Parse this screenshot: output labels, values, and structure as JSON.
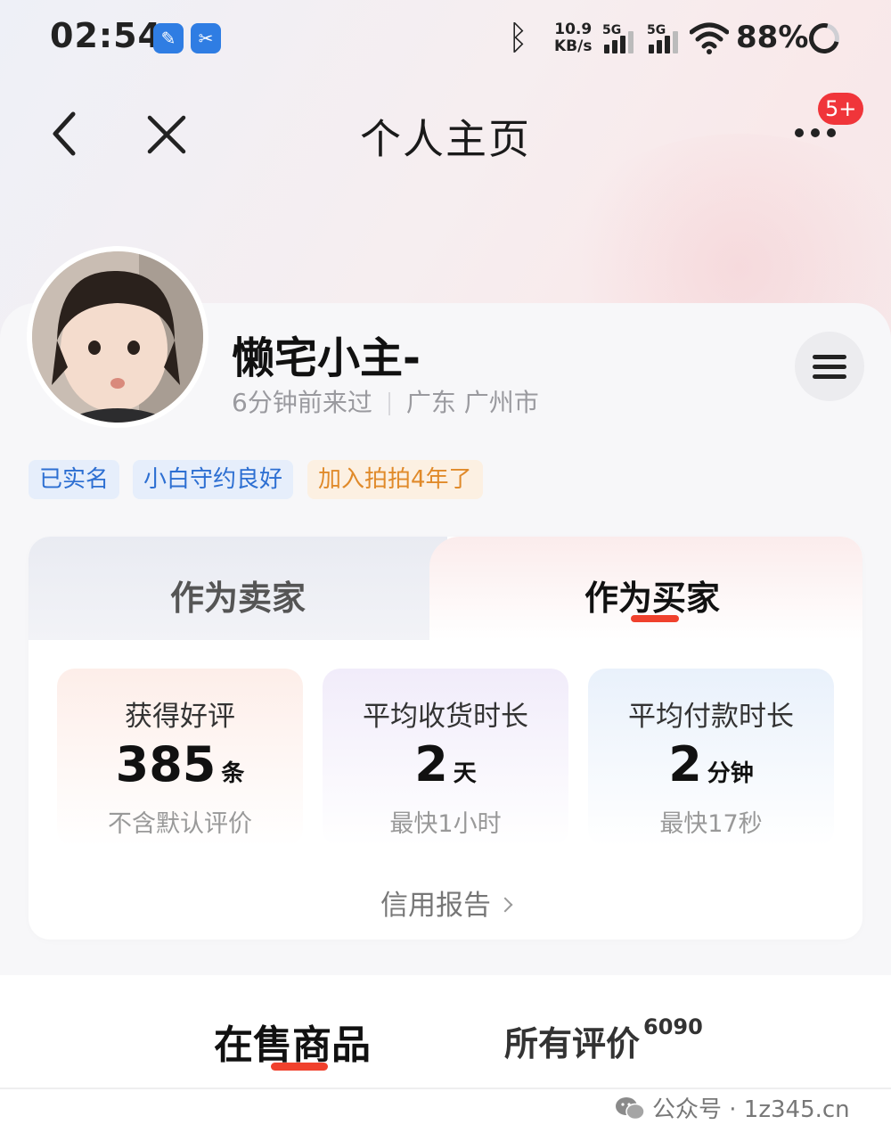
{
  "status_bar": {
    "time": "02:54",
    "net_speed_value": "10.9",
    "net_speed_unit": "KB/s",
    "signal_1_label": "5G",
    "signal_2_label": "5G",
    "battery": "88%"
  },
  "nav": {
    "title": "个人主页",
    "badge": "5+"
  },
  "profile": {
    "username": "懒宅小主-",
    "last_visit": "6分钟前来过",
    "location": "广东 广州市"
  },
  "tags": [
    {
      "label": "已实名"
    },
    {
      "label": "小白守约良好"
    },
    {
      "label": "加入拍拍4年了"
    }
  ],
  "role_tabs": {
    "seller": "作为卖家",
    "buyer": "作为买家"
  },
  "stats": [
    {
      "title": "获得好评",
      "value": "385",
      "unit": "条",
      "sub": "不含默认评价"
    },
    {
      "title": "平均收货时长",
      "value": "2",
      "unit": "天",
      "sub": "最快1小时"
    },
    {
      "title": "平均付款时长",
      "value": "2",
      "unit": "分钟",
      "sub": "最快17秒"
    }
  ],
  "credit_report": "信用报告",
  "bottom_tabs": {
    "on_sale": "在售商品",
    "reviews": "所有评价",
    "reviews_count": "6090"
  },
  "watermark": "公众号 · 1z345.cn",
  "colors": {
    "accent": "#f0412d",
    "badge": "#f0353a",
    "tag_blue": "#2d6fd2",
    "tag_orange": "#e08a2a"
  }
}
